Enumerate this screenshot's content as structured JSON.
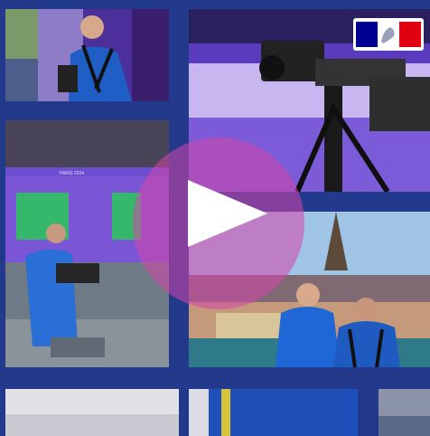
{
  "video": {
    "play_state": "paused",
    "colors": {
      "frame": "#233a8c",
      "play_overlay": "#d646aa",
      "venue_purple": "#5a3bbd"
    }
  },
  "tiles": {
    "court_banner": {
      "text": "PARIS 2024"
    }
  },
  "badge": {
    "flag_colors": [
      "#000091",
      "#ffffff",
      "#e1000f"
    ]
  }
}
